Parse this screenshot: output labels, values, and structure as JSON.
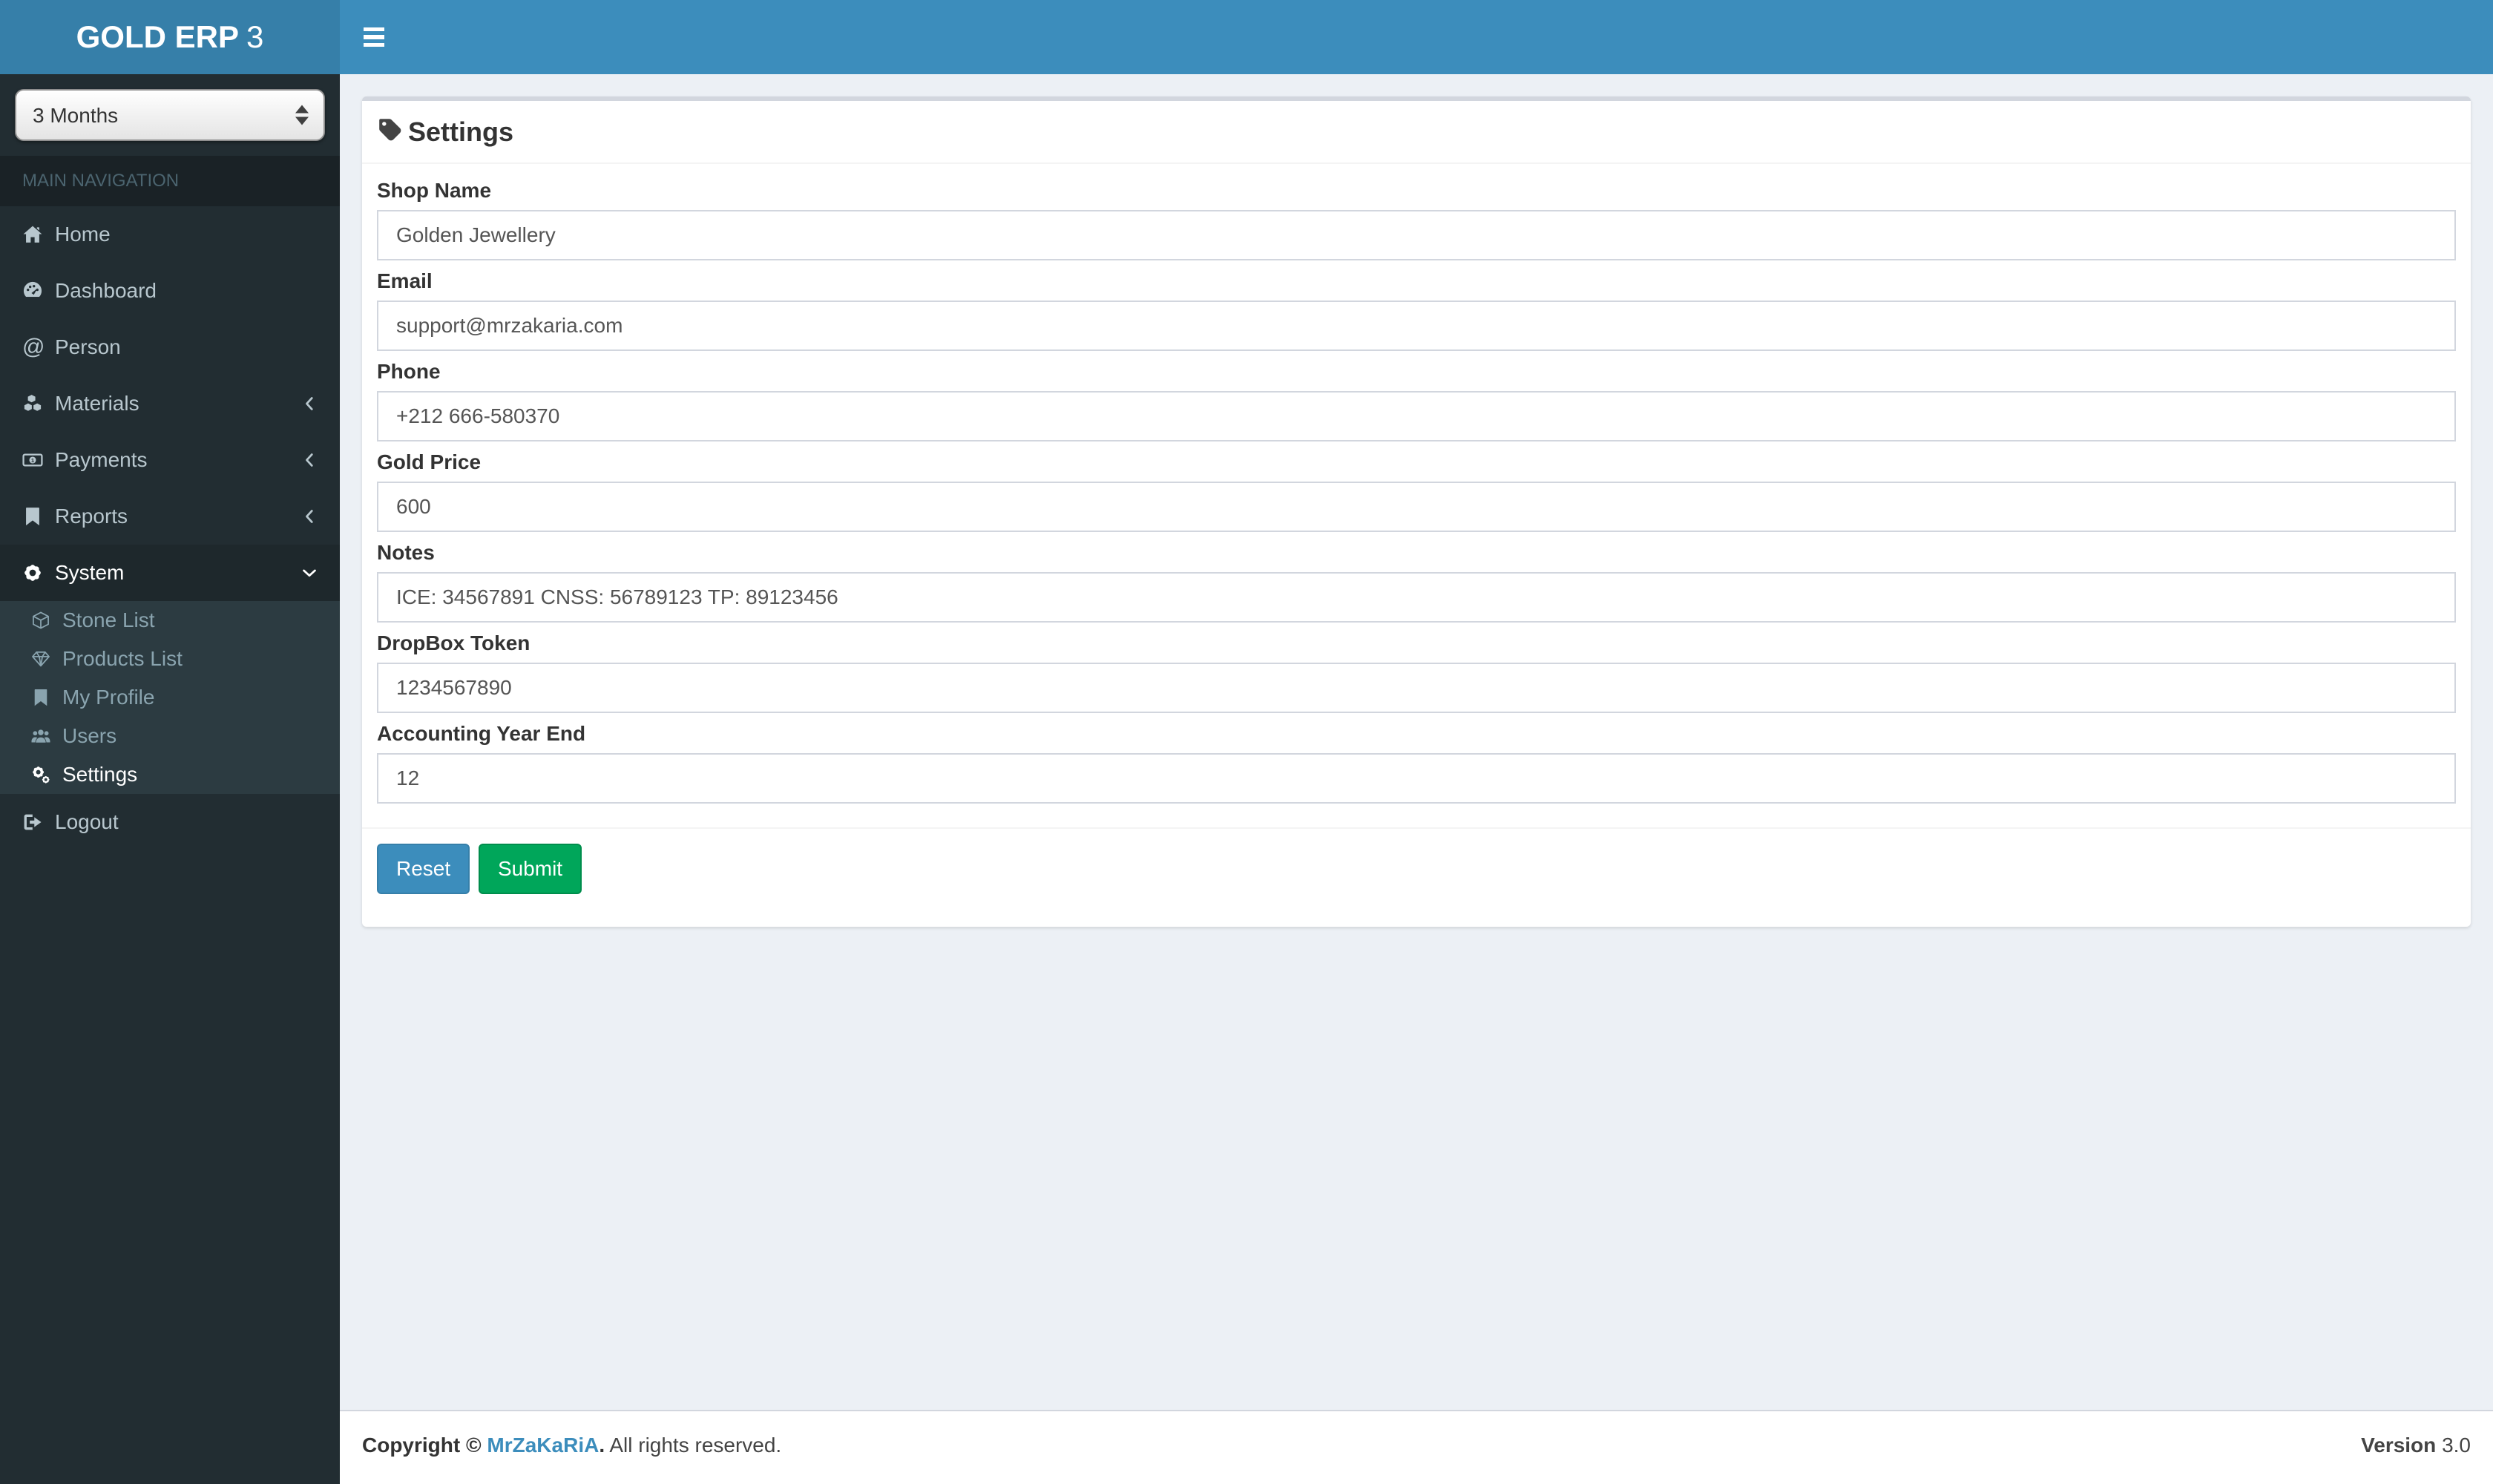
{
  "brand": {
    "name_bold": "GOLD ERP",
    "name_suffix": "3"
  },
  "sidebar": {
    "period_select": {
      "value": "3 Months",
      "icon": "spinner-arrows-icon"
    },
    "section_header": "MAIN NAVIGATION",
    "items": [
      {
        "label": "Home",
        "icon": "home-icon"
      },
      {
        "label": "Dashboard",
        "icon": "dashboard-icon"
      },
      {
        "label": "Person",
        "icon": "at-icon"
      },
      {
        "label": "Materials",
        "icon": "cubes-icon",
        "chevron": "angle-left"
      },
      {
        "label": "Payments",
        "icon": "money-icon",
        "chevron": "angle-left"
      },
      {
        "label": "Reports",
        "icon": "bookmark-icon",
        "chevron": "angle-left"
      },
      {
        "label": "System",
        "icon": "gear-icon",
        "chevron": "angle-down",
        "active": true
      }
    ],
    "system_submenu": [
      {
        "label": "Stone List",
        "icon": "cube-icon"
      },
      {
        "label": "Products List",
        "icon": "diamond-icon"
      },
      {
        "label": "My Profile",
        "icon": "bookmark-icon"
      },
      {
        "label": "Users",
        "icon": "users-icon"
      },
      {
        "label": "Settings",
        "icon": "gears-icon",
        "active": true
      }
    ],
    "logout_label": "Logout"
  },
  "settings_card": {
    "title": "Settings",
    "title_icon": "tag-icon",
    "fields": [
      {
        "label": "Shop Name",
        "value": "Golden Jewellery"
      },
      {
        "label": "Email",
        "value": "support@mrzakaria.com"
      },
      {
        "label": "Phone",
        "value": "+212 666-580370"
      },
      {
        "label": "Gold Price",
        "value": "600"
      },
      {
        "label": "Notes",
        "value": "ICE: 34567891 CNSS: 56789123 TP: 89123456"
      },
      {
        "label": "DropBox Token",
        "value": "1234567890"
      },
      {
        "label": "Accounting Year End",
        "value": "12"
      }
    ],
    "reset_label": "Reset",
    "submit_label": "Submit"
  },
  "footer": {
    "copyright_prefix": "Copyright © ",
    "author": "MrZaKaRiA",
    "copyright_suffix_bold": ".",
    "rights": " All rights reserved.",
    "version_label": "Version",
    "version_value": "3.0"
  },
  "colors": {
    "navbar": "#3c8dbc",
    "logo_bg": "#367fa9",
    "sidebar_bg": "#222d32",
    "sidebar_active_bg": "#1e282c",
    "submenu_bg": "#2c3b41",
    "content_bg": "#ecf0f5",
    "primary_button": "#3c8dbc",
    "success_button": "#00a65a",
    "input_border": "#d2d6de"
  }
}
